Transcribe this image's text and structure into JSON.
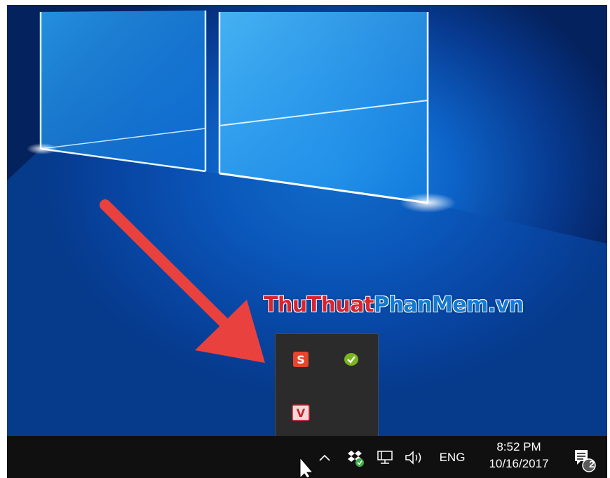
{
  "watermark": {
    "part1": "ThuThuat",
    "part2": "PhanMem.vn"
  },
  "tray_flyout": {
    "icons": [
      {
        "name": "snagit-icon",
        "letter": "S",
        "color": "#e8452c"
      },
      {
        "name": "skype-status-icon",
        "color": "#7ab51d"
      },
      {
        "name": "v-app-icon",
        "letter": "V",
        "color": "#c8232c"
      }
    ]
  },
  "taskbar": {
    "show_hidden_icons": "^",
    "language": "ENG",
    "time": "8:52 PM",
    "date": "10/16/2017",
    "notification_count": "2"
  },
  "colors": {
    "annotation_arrow": "#e8413e",
    "taskbar": "#101010",
    "flyout": "#2b2b2b"
  }
}
